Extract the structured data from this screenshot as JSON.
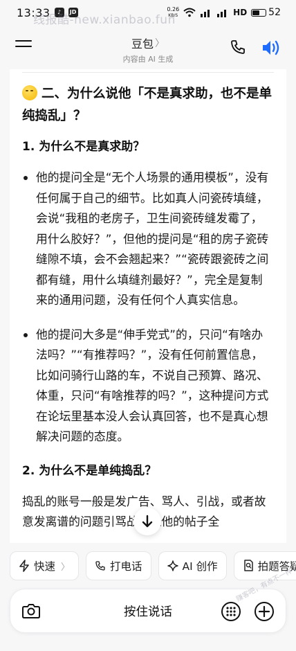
{
  "status_bar": {
    "time": "13:33",
    "net_speed_value": "0.26",
    "net_speed_unit": "KB/S",
    "signal_label": "HD",
    "battery": "52"
  },
  "watermarks": {
    "top": "线报酷-new.xianbao.fun",
    "bottom": "赚客吧，有点不一样~ zuanke8"
  },
  "header": {
    "title": "豆包",
    "title_chevron": "〉",
    "subtitle": "内容由 AI 生成"
  },
  "content": {
    "section_title": "二、为什么说他「不是真求助，也不是单纯捣乱」？",
    "sub1_title": "1. 为什么不是真求助？",
    "bullets": [
      "他的提问全是“无个人场景的通用模板”，没有任何属于自己的细节。比如真人问瓷砖填缝，会说“我租的老房子，卫生间瓷砖缝发霉了，用什么胶好？”，但他的提问是“租的房子瓷砖缝隙不填，会不会翘起来？”“瓷砖跟瓷砖之间都有缝，用什么填缝剂最好？”，完全是复制来的通用问题，没有任何个人真实信息。",
      "他的提问大多是“伸手党式”的，只问“有啥办法吗？”“有推荐吗？”，没有任何前置信息，比如问骑行山路的车，不说自己预算、路况、体重，只问“有啥推荐的吗？”，这种提问方式在论坛里基本没人会认真回答，也不是真心想解决问题的态度。"
    ],
    "sub2_title": "2. 为什么不是单纯捣乱？",
    "para": "捣乱的账号一般是发广告、骂人、引战，或者故意发离谱的问题引骂战，但他的帖子全"
  },
  "chips": [
    {
      "label": "快速",
      "chevron": "〉"
    },
    {
      "label": "打电话"
    },
    {
      "label": "AI 创作"
    },
    {
      "label": "拍题答疑"
    }
  ],
  "input_bar": {
    "hold_to_talk": "按住说话"
  },
  "colors": {
    "accent_blue": "#1e6bff",
    "background": "#f7f7f8",
    "card": "#ffffff"
  },
  "icons": [
    "menu-icon",
    "phone-icon",
    "speaker-icon",
    "arrow-down-icon",
    "bolt-icon",
    "phone-icon",
    "sparkle-icon",
    "doc-search-icon",
    "camera-icon",
    "keypad-icon",
    "plus-icon"
  ]
}
